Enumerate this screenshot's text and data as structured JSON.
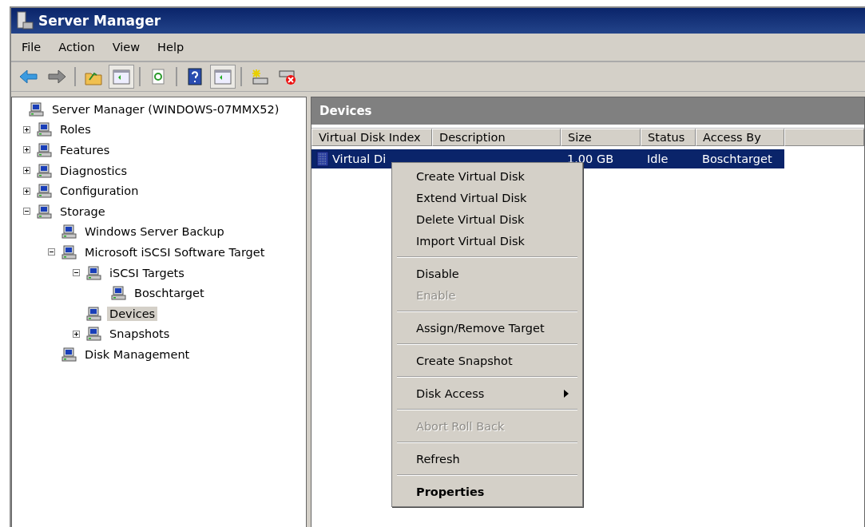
{
  "window": {
    "title": "Server Manager"
  },
  "menu_bar": [
    "File",
    "Action",
    "View",
    "Help"
  ],
  "toolbar": [
    [
      {
        "on": false
      },
      {
        "on": false
      }
    ],
    [
      {
        "on": false
      },
      {
        "on": true
      }
    ],
    [
      {
        "on": false
      }
    ],
    [
      {
        "on": false
      },
      {
        "on": true
      }
    ],
    [
      {
        "on": false
      },
      {
        "on": false
      }
    ]
  ],
  "tree": [
    {
      "label": "Server Manager (WINDOWS-07MMX52)",
      "selected": false,
      "children": [
        {
          "label": "Roles",
          "expanded": false,
          "selected": false
        },
        {
          "label": "Features",
          "expanded": false,
          "selected": false
        },
        {
          "label": "Diagnostics",
          "expanded": false,
          "selected": false
        },
        {
          "label": "Configuration",
          "expanded": false,
          "selected": false
        },
        {
          "label": "Storage",
          "expanded": true,
          "selected": false,
          "children": [
            {
              "label": "Windows Server Backup",
              "selected": false
            },
            {
              "label": "Microsoft iSCSI Software Target",
              "expanded": true,
              "selected": false,
              "children": [
                {
                  "label": "iSCSI Targets",
                  "expanded": true,
                  "selected": false,
                  "children": [
                    {
                      "label": "Boschtarget",
                      "selected": false
                    }
                  ]
                },
                {
                  "label": "Devices",
                  "selected": true
                },
                {
                  "label": "Snapshots",
                  "expanded": false,
                  "selected": false
                }
              ]
            },
            {
              "label": "Disk Management",
              "selected": false
            }
          ]
        }
      ]
    }
  ],
  "panel": {
    "title": "Devices"
  },
  "table": {
    "columns": [
      "Virtual Disk Index",
      "Description",
      "Size",
      "Status",
      "Access By"
    ],
    "rows": [
      {
        "selected": true,
        "cells": [
          "Virtual Di",
          "",
          "1.00 GB",
          "Idle",
          "Boschtarget"
        ]
      }
    ]
  },
  "context_menu": [
    [
      {
        "label": "Create Virtual Disk",
        "disabled": false
      },
      {
        "label": "Extend Virtual Disk",
        "disabled": false
      },
      {
        "label": "Delete Virtual Disk",
        "disabled": false
      },
      {
        "label": "Import Virtual Disk",
        "disabled": false
      }
    ],
    [
      {
        "label": "Disable",
        "disabled": false
      },
      {
        "label": "Enable",
        "disabled": true
      }
    ],
    [
      {
        "label": "Assign/Remove Target",
        "disabled": false
      }
    ],
    [
      {
        "label": "Create Snapshot",
        "disabled": false
      }
    ],
    [
      {
        "label": "Disk Access",
        "disabled": false,
        "submenu": true
      }
    ],
    [
      {
        "label": "Abort Roll Back",
        "disabled": true
      }
    ],
    [
      {
        "label": "Refresh",
        "disabled": false
      }
    ],
    [
      {
        "label": "Properties",
        "disabled": false,
        "default": true
      }
    ]
  ]
}
